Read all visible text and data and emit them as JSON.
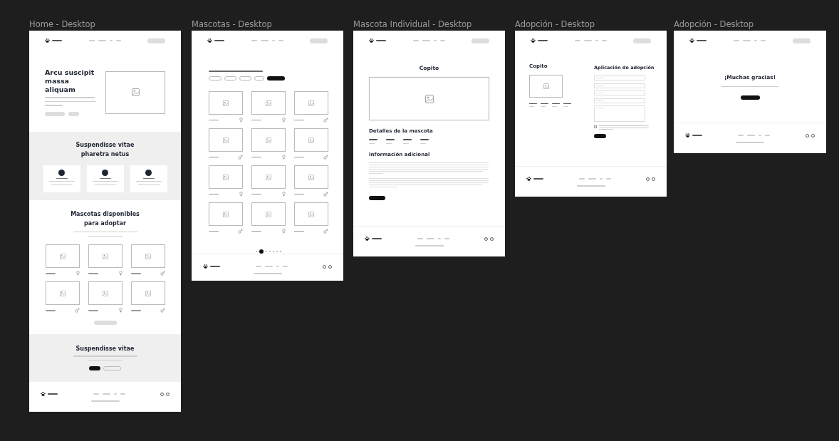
{
  "frames": [
    {
      "label": "Home - Desktop",
      "kind": "home",
      "hero_title": "Arcu suscipit massa aliquam",
      "features_title": "Suspendisse vitae pharetra netus",
      "pets_title": "Mascotas disponibles para adoptar",
      "pets": [
        {
          "kind": "female"
        },
        {
          "kind": "female"
        },
        {
          "kind": "male"
        },
        {
          "kind": "male"
        },
        {
          "kind": "female"
        },
        {
          "kind": "male"
        }
      ],
      "cta_title": "Suspendisse vitae"
    },
    {
      "label": "Mascotas - Desktop",
      "kind": "list",
      "pets": [
        {
          "kind": "female"
        },
        {
          "kind": "female"
        },
        {
          "kind": "male"
        },
        {
          "kind": "male"
        },
        {
          "kind": "female"
        },
        {
          "kind": "male"
        },
        {
          "kind": "female"
        },
        {
          "kind": "female"
        },
        {
          "kind": "male"
        },
        {
          "kind": "male"
        },
        {
          "kind": "female"
        },
        {
          "kind": "male"
        }
      ]
    },
    {
      "label": "Mascota Individual - Desktop",
      "kind": "detail",
      "title": "Copito",
      "details_title": "Detalles de la mascota",
      "info_title": "Información adicional"
    },
    {
      "label": "Adopción - Desktop",
      "kind": "form",
      "title": "Copito",
      "form_title": "Aplicación de adopción",
      "checkbox": {
        "checked": false
      }
    },
    {
      "label": "Adopción - Desktop",
      "kind": "thanks",
      "title": "¡Muchas gracias!"
    }
  ]
}
